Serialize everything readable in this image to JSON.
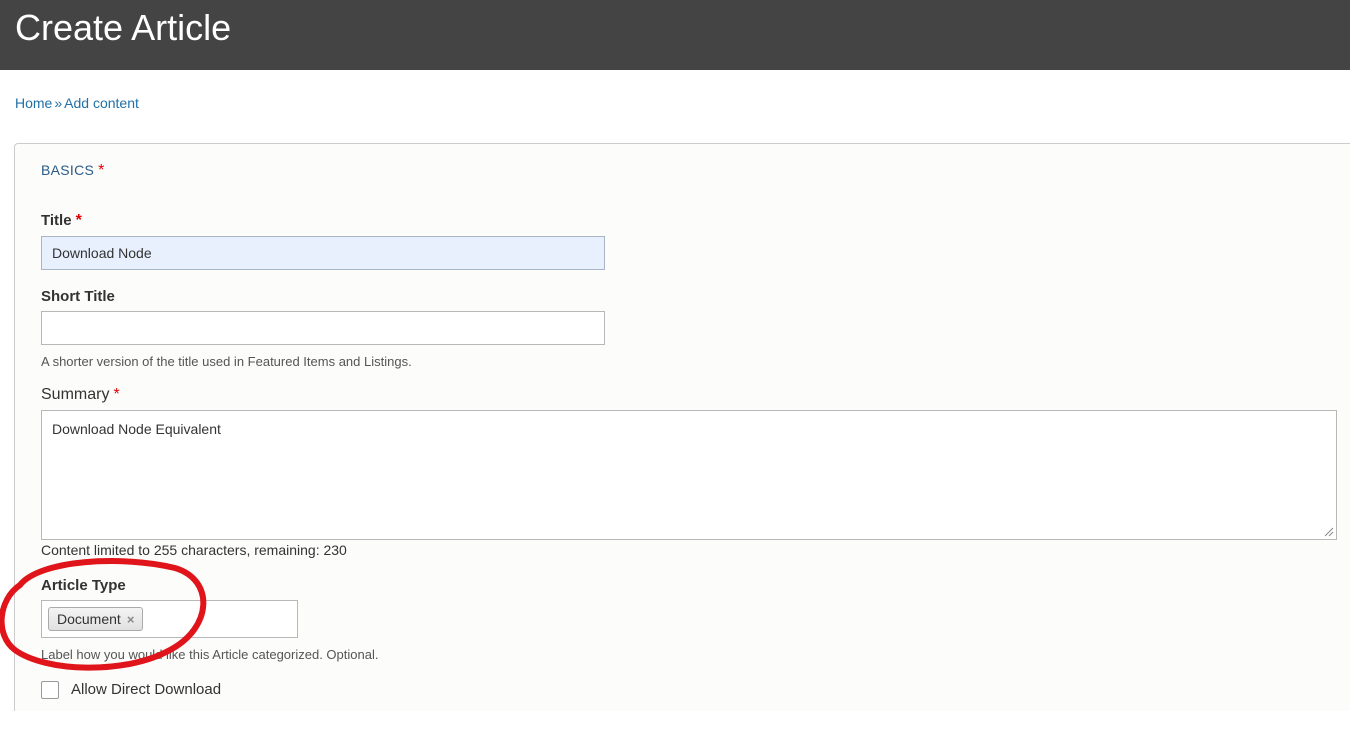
{
  "header": {
    "title": "Create Article"
  },
  "breadcrumb": {
    "items": [
      "Home",
      "Add content"
    ],
    "separator": "»"
  },
  "form": {
    "section_legend": "BASICS",
    "required_marker": "*",
    "fields": {
      "title": {
        "label": "Title",
        "value": "Download Node"
      },
      "short_title": {
        "label": "Short Title",
        "value": "",
        "help": "A shorter version of the title used in Featured Items and Listings."
      },
      "summary": {
        "label": "Summary",
        "value": "Download Node Equivalent",
        "counter": "Content limited to 255 characters, remaining: 230"
      },
      "article_type": {
        "label": "Article Type",
        "tags": [
          "Document"
        ],
        "remove_glyph": "×",
        "help": "Label how you would like this Article categorized. Optional."
      },
      "allow_direct_download": {
        "label": "Allow Direct Download",
        "checked": false
      }
    }
  },
  "colors": {
    "header_bg": "#444444",
    "link": "#2270a8",
    "required": "#e00000",
    "annotation_circle": "#e0151b",
    "autofill_bg": "#e8f0fe"
  }
}
